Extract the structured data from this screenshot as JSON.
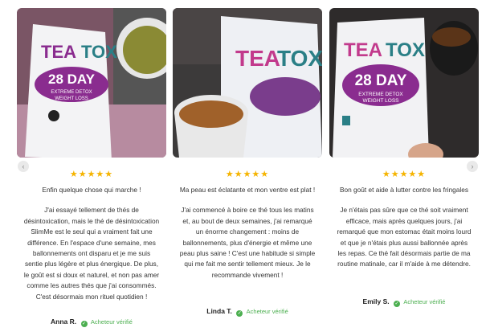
{
  "reviews": [
    {
      "stars": "★★★★★",
      "title": "Enfin quelque chose qui marche !",
      "body": "J'ai essayé tellement de thés de désintoxication, mais le thé de désintoxication SlimMe est le seul qui a vraiment fait une différence. En l'espace d'une semaine, mes ballonnements ont disparu et je me suis sentie plus légère et plus énergique. De plus, le goût est si doux et naturel, et non pas amer comme les autres thés que j'ai consommés. C'est désormais mon rituel quotidien !",
      "author": "Anna R.",
      "verified": "Acheteur vérifié"
    },
    {
      "stars": "★★★★★",
      "title": "Ma peau est éclatante et mon ventre est plat !",
      "body": "J'ai commencé à boire ce thé tous les matins et, au bout de deux semaines, j'ai remarqué un énorme changement : moins de ballonnements, plus d'énergie et même une peau plus saine ! C'est une habitude si simple qui me fait me sentir tellement mieux. Je le recommande vivement !",
      "author": "Linda T.",
      "verified": "Acheteur vérifié"
    },
    {
      "stars": "★★★★★",
      "title": "Bon goût et aide à lutter contre les fringales",
      "body": "Je n'étais pas sûre que ce thé soit vraiment efficace, mais après quelques jours, j'ai remarqué que mon estomac était moins lourd et que je n'étais plus aussi ballonnée après les repas. Ce thé fait désormais partie de ma routine matinale, car il m'aide à me détendre.",
      "author": "Emily S.",
      "verified": "Acheteur vérifié"
    }
  ],
  "product": {
    "brand_tea": "TEA",
    "brand_tox": "TOX",
    "day_label": "28 DAY",
    "line1": "EXTREME DETOX",
    "line2": "WEIGHT LOSS"
  },
  "nav": {
    "prev": "‹",
    "next": "›"
  },
  "icons": {
    "verified": "check-circle-icon",
    "prev": "chevron-left-icon",
    "next": "chevron-right-icon"
  },
  "colors": {
    "star": "#f5b400",
    "verified": "#4caf50",
    "brand_purple": "#8a2c8f",
    "brand_teal": "#2a7f86"
  }
}
